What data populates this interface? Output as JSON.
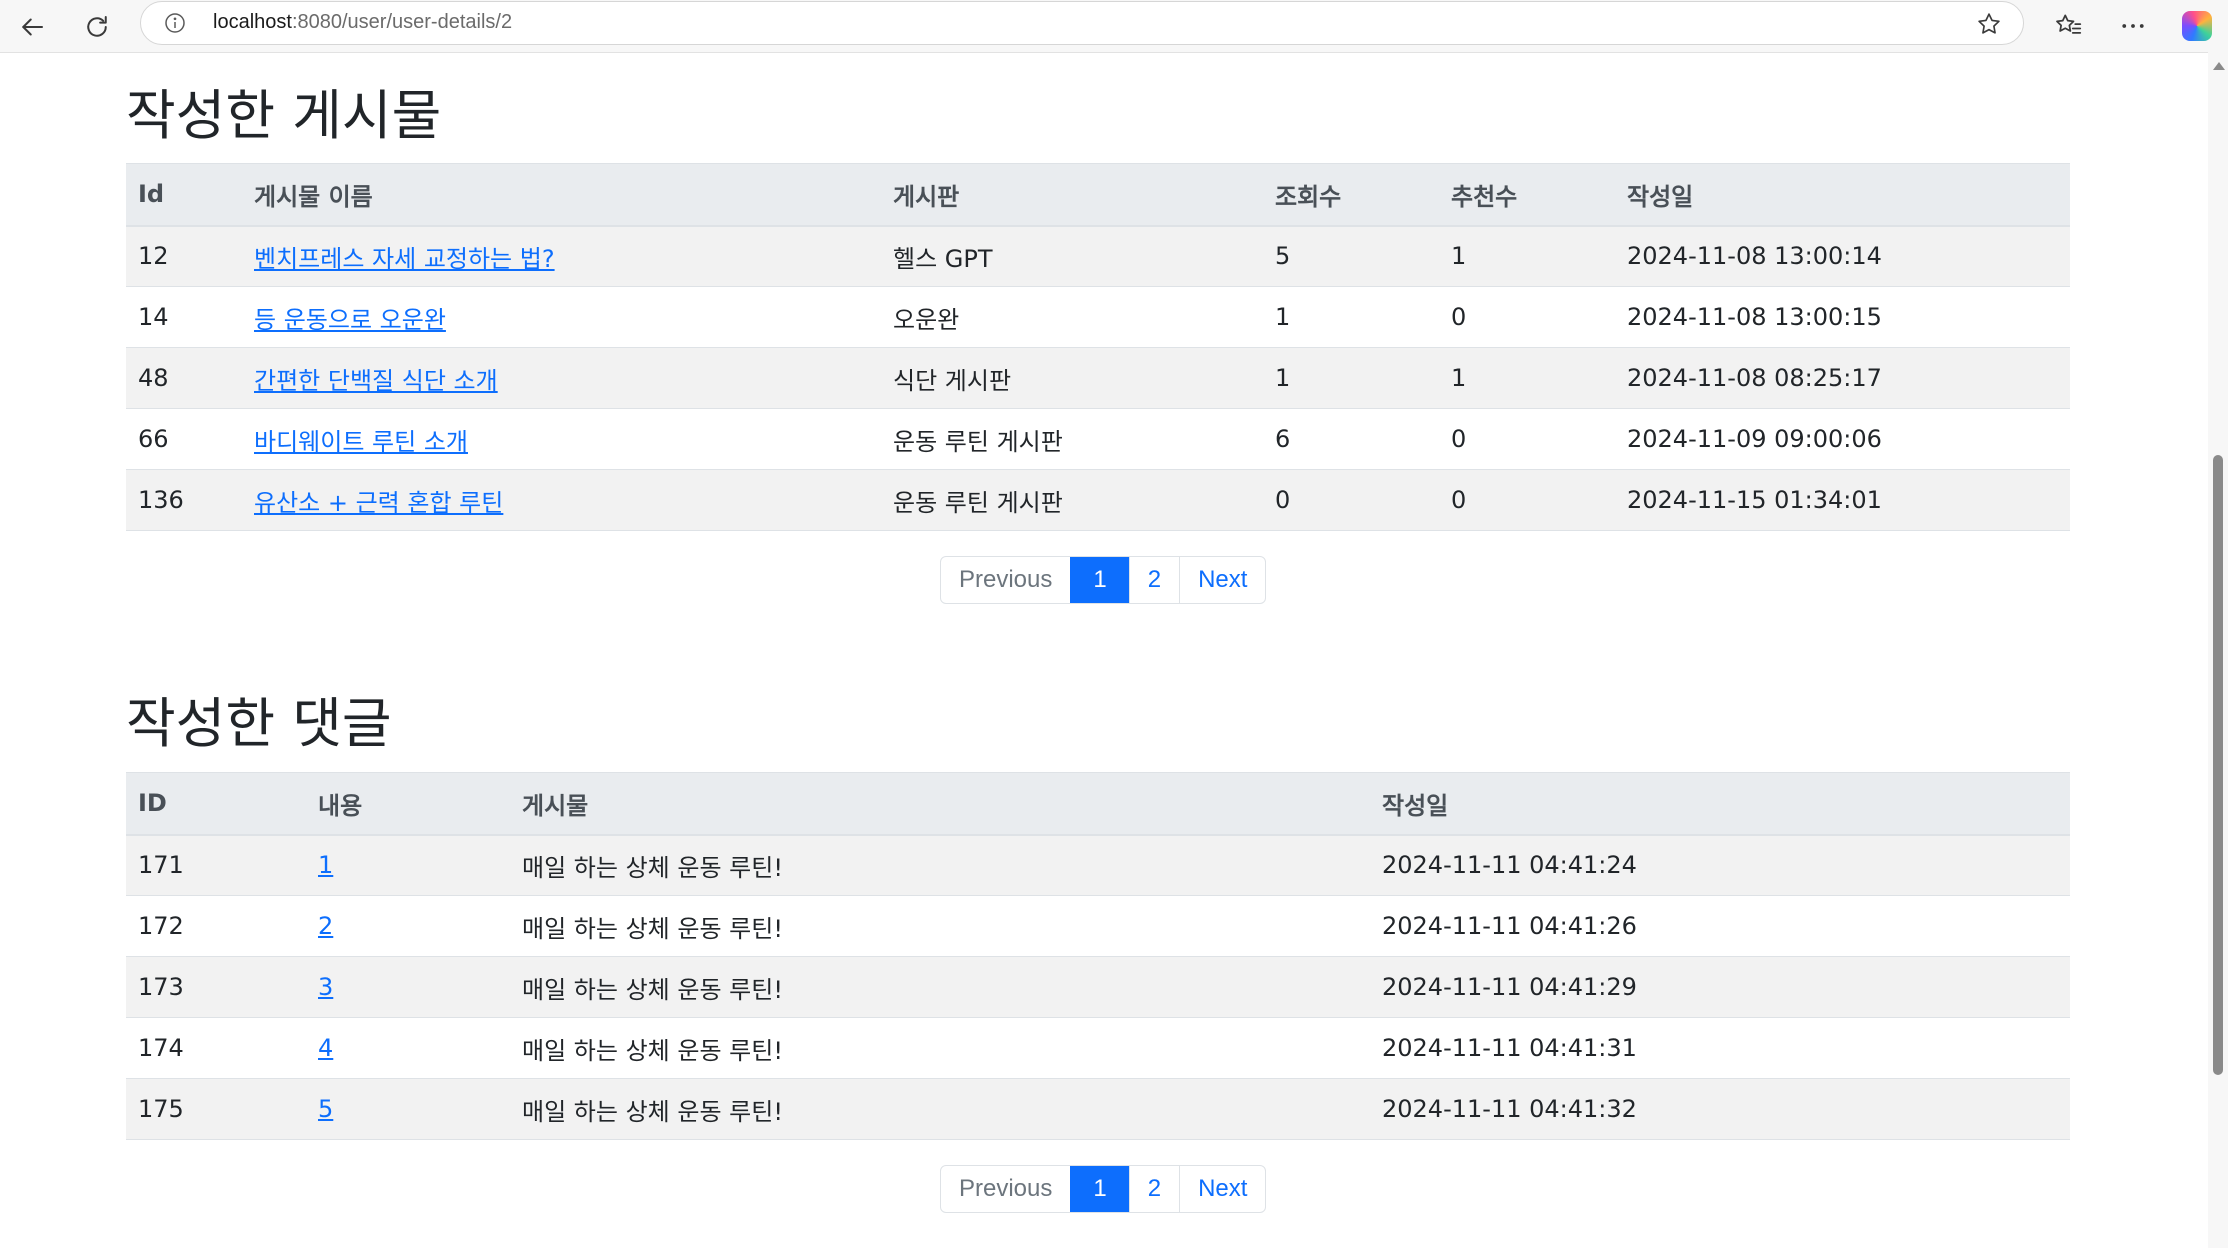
{
  "browser": {
    "url_host": "localhost",
    "url_path": ":8080/user/user-details/2"
  },
  "posts": {
    "title": "작성한 게시물",
    "columns": [
      "Id",
      "게시물 이름",
      "게시판",
      "조회수",
      "추천수",
      "작성일"
    ],
    "rows": [
      {
        "id": "12",
        "name": "벤치프레스 자세 교정하는 법?",
        "board": "헬스 GPT",
        "views": "5",
        "likes": "1",
        "date": "2024-11-08 13:00:14"
      },
      {
        "id": "14",
        "name": "등 운동으로 오운완",
        "board": "오운완",
        "views": "1",
        "likes": "0",
        "date": "2024-11-08 13:00:15"
      },
      {
        "id": "48",
        "name": "간편한 단백질 식단 소개",
        "board": "식단 게시판",
        "views": "1",
        "likes": "1",
        "date": "2024-11-08 08:25:17"
      },
      {
        "id": "66",
        "name": "바디웨이트 루틴 소개",
        "board": "운동 루틴 게시판",
        "views": "6",
        "likes": "0",
        "date": "2024-11-09 09:00:06"
      },
      {
        "id": "136",
        "name": "유산소 + 근력 혼합 루틴",
        "board": "운동 루틴 게시판",
        "views": "0",
        "likes": "0",
        "date": "2024-11-15 01:34:01"
      }
    ],
    "pagination": {
      "previous": "Previous",
      "pages": [
        "1",
        "2"
      ],
      "next": "Next",
      "active": "1"
    }
  },
  "comments": {
    "title": "작성한 댓글",
    "columns": [
      "ID",
      "내용",
      "게시물",
      "작성일"
    ],
    "rows": [
      {
        "id": "171",
        "content": "1",
        "post": "매일 하는 상체 운동 루틴!",
        "date": "2024-11-11 04:41:24"
      },
      {
        "id": "172",
        "content": "2",
        "post": "매일 하는 상체 운동 루틴!",
        "date": "2024-11-11 04:41:26"
      },
      {
        "id": "173",
        "content": "3",
        "post": "매일 하는 상체 운동 루틴!",
        "date": "2024-11-11 04:41:29"
      },
      {
        "id": "174",
        "content": "4",
        "post": "매일 하는 상체 운동 루틴!",
        "date": "2024-11-11 04:41:31"
      },
      {
        "id": "175",
        "content": "5",
        "post": "매일 하는 상체 운동 루틴!",
        "date": "2024-11-11 04:41:32"
      }
    ],
    "pagination": {
      "previous": "Previous",
      "pages": [
        "1",
        "2"
      ],
      "next": "Next",
      "active": "1"
    }
  },
  "colors": {
    "link": "#0d6efd",
    "table_header_bg": "#e9ecef",
    "stripe_bg": "#f2f2f2",
    "pagination_active_bg": "#0d6efd"
  },
  "icons": [
    "back-arrow-icon",
    "refresh-icon",
    "info-icon",
    "star-icon",
    "favorites-icon",
    "more-icon",
    "copilot-icon"
  ]
}
